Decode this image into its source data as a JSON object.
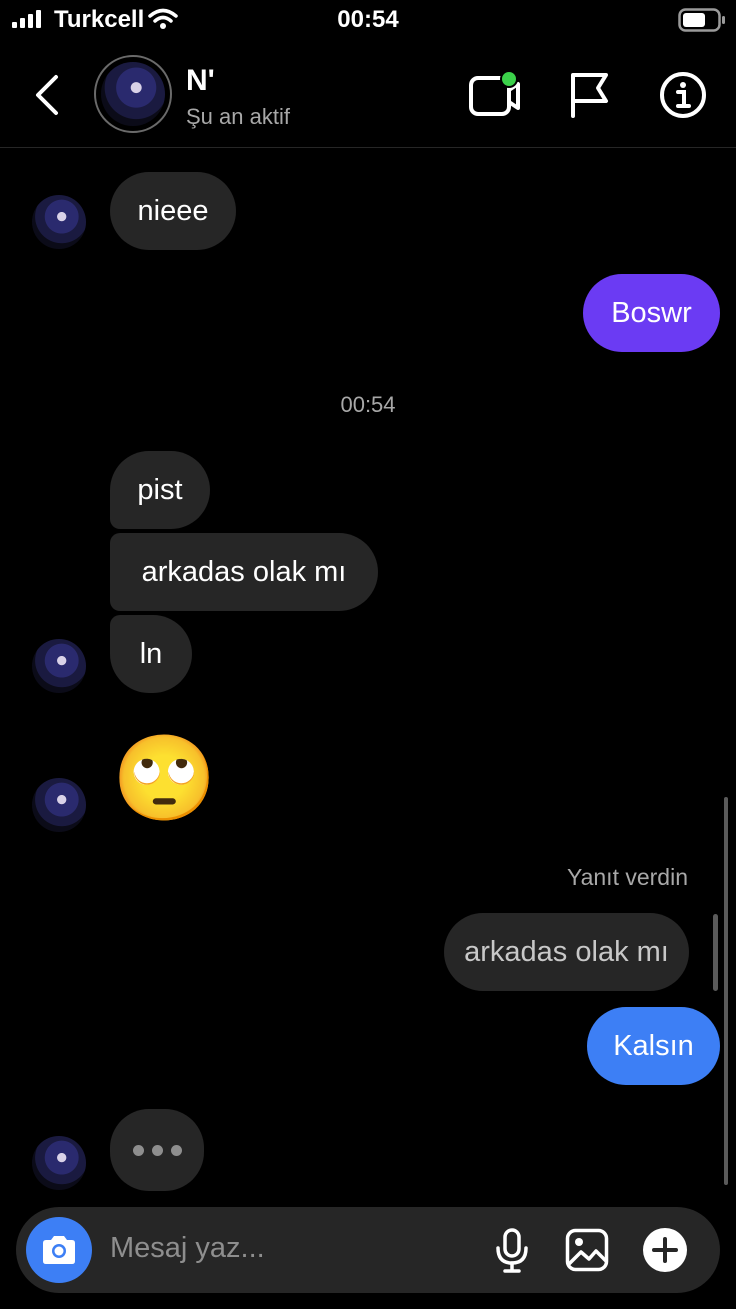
{
  "status_bar": {
    "carrier": "Turkcell",
    "time": "00:54"
  },
  "header": {
    "title": "N'",
    "subtitle": "Şu an aktif"
  },
  "messages": [
    {
      "text": "nieee"
    },
    {
      "text": "Boswr"
    },
    {
      "text": "pist"
    },
    {
      "text": "arkadas olak mı"
    },
    {
      "text": "ln"
    },
    {
      "text": "🙄"
    },
    {
      "text": "arkadas olak mı"
    },
    {
      "text": "Kalsın"
    }
  ],
  "time_separator": "00:54",
  "replied_label": "Yanıt verdin",
  "composer": {
    "placeholder": "Mesaj yaz..."
  },
  "colors": {
    "sent_purple": "#6b3bf3",
    "sent_blue": "#3d7ff5",
    "received": "#262626",
    "active_dot": "#3bd14a"
  },
  "icons": [
    "back-icon",
    "video-call-icon",
    "flag-icon",
    "info-icon",
    "camera-icon",
    "microphone-icon",
    "gallery-icon",
    "plus-icon",
    "typing-indicator-icon"
  ]
}
